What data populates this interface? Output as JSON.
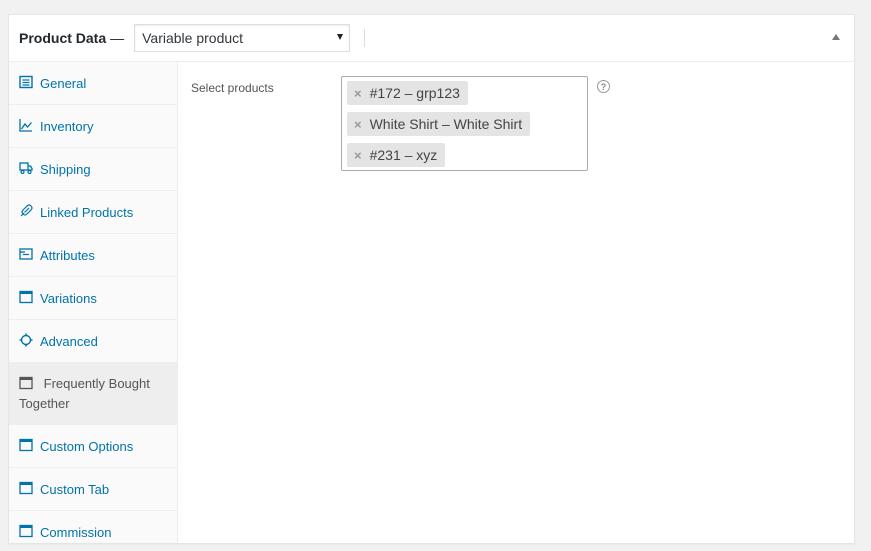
{
  "header": {
    "title": "Product Data",
    "dash": "—",
    "product_type": "Variable product"
  },
  "tabs": [
    {
      "label": "General",
      "icon": "general-icon"
    },
    {
      "label": "Inventory",
      "icon": "inventory-icon"
    },
    {
      "label": "Shipping",
      "icon": "truck-icon"
    },
    {
      "label": "Linked Products",
      "icon": "link-icon"
    },
    {
      "label": "Attributes",
      "icon": "attributes-icon"
    },
    {
      "label": "Variations",
      "icon": "window-icon"
    },
    {
      "label": "Advanced",
      "icon": "gear-icon"
    },
    {
      "label": "Frequently Bought Together",
      "icon": "window-icon",
      "active": true
    },
    {
      "label": "Custom Options",
      "icon": "window-icon"
    },
    {
      "label": "Custom Tab",
      "icon": "window-icon"
    },
    {
      "label": "Commission",
      "icon": "window-icon"
    }
  ],
  "main": {
    "field_label": "Select products",
    "selected_products": [
      "#172 – grp123",
      "White Shirt – White Shirt",
      "#231 – xyz"
    ],
    "remove_symbol": "×",
    "help_symbol": "?"
  },
  "colors": {
    "link": "#0073aa",
    "active_tab_bg": "#eeeeee",
    "chip_bg": "#e4e4e4"
  }
}
